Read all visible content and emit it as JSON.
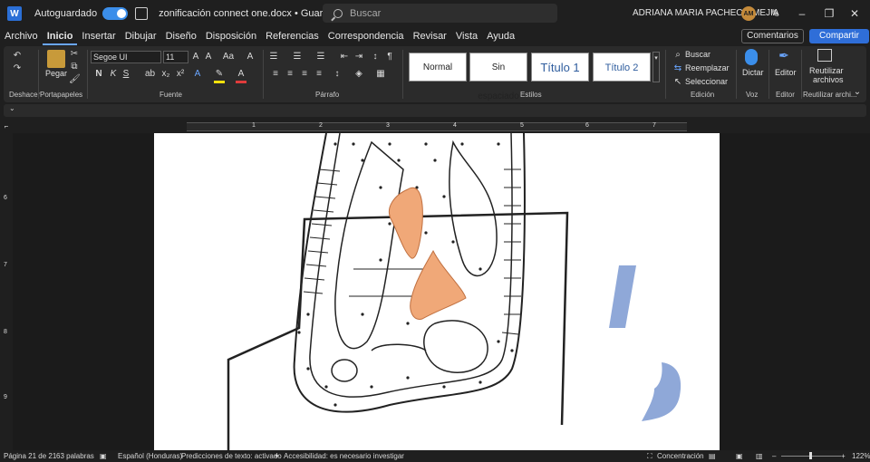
{
  "titlebar": {
    "autosave_label": "Autoguardado",
    "document_title": "zonificación connect one.docx • Guardando... ˅",
    "search_placeholder": "Buscar",
    "user_name": "ADRIANA MARIA PACHECO MEJIA",
    "user_initials": "AM"
  },
  "menu": {
    "tabs": [
      "Archivo",
      "Inicio",
      "Insertar",
      "Dibujar",
      "Diseño",
      "Disposición",
      "Referencias",
      "Correspondencia",
      "Revisar",
      "Vista",
      "Ayuda"
    ],
    "comments_label": "Comentarios",
    "share_label": "Compartir"
  },
  "ribbon": {
    "groups": {
      "undo": "Deshacer",
      "clipboard": "Portapapeles",
      "font": "Fuente",
      "paragraph": "Párrafo",
      "styles": "Estilos",
      "editing": "Edición",
      "voice": "Voz",
      "editor": "Editor",
      "reuse": "Reutilizar archi..."
    },
    "paste_label": "Pegar",
    "font_name": "Segoe UI",
    "font_size": "11",
    "styles": [
      "Normal",
      "Sin espaciado",
      "Título 1",
      "Título 2"
    ],
    "find_label": "Buscar",
    "replace_label": "Reemplazar",
    "select_label": "Seleccionar",
    "dictate_label": "Dictar",
    "editor_label": "Editor",
    "reuse_label_1": "Reutilizar",
    "reuse_label_2": "archivos"
  },
  "ruler": {
    "numbers": [
      "1",
      "2",
      "3",
      "4",
      "5",
      "6",
      "7"
    ]
  },
  "vruler": {
    "numbers": [
      "6",
      "7",
      "8",
      "9"
    ]
  },
  "status": {
    "page": "Página 21 de 21",
    "words": "63 palabras",
    "language": "Español (Honduras)",
    "predictions": "Predicciones de texto: activado",
    "accessibility": "Accesibilidad: es necesario investigar",
    "focus": "Concentración",
    "zoom": "122%"
  },
  "colors": {
    "accent": "#2f6ed8",
    "highlight_orange": "#f0a878",
    "shape_blue": "#8fa8d8"
  }
}
